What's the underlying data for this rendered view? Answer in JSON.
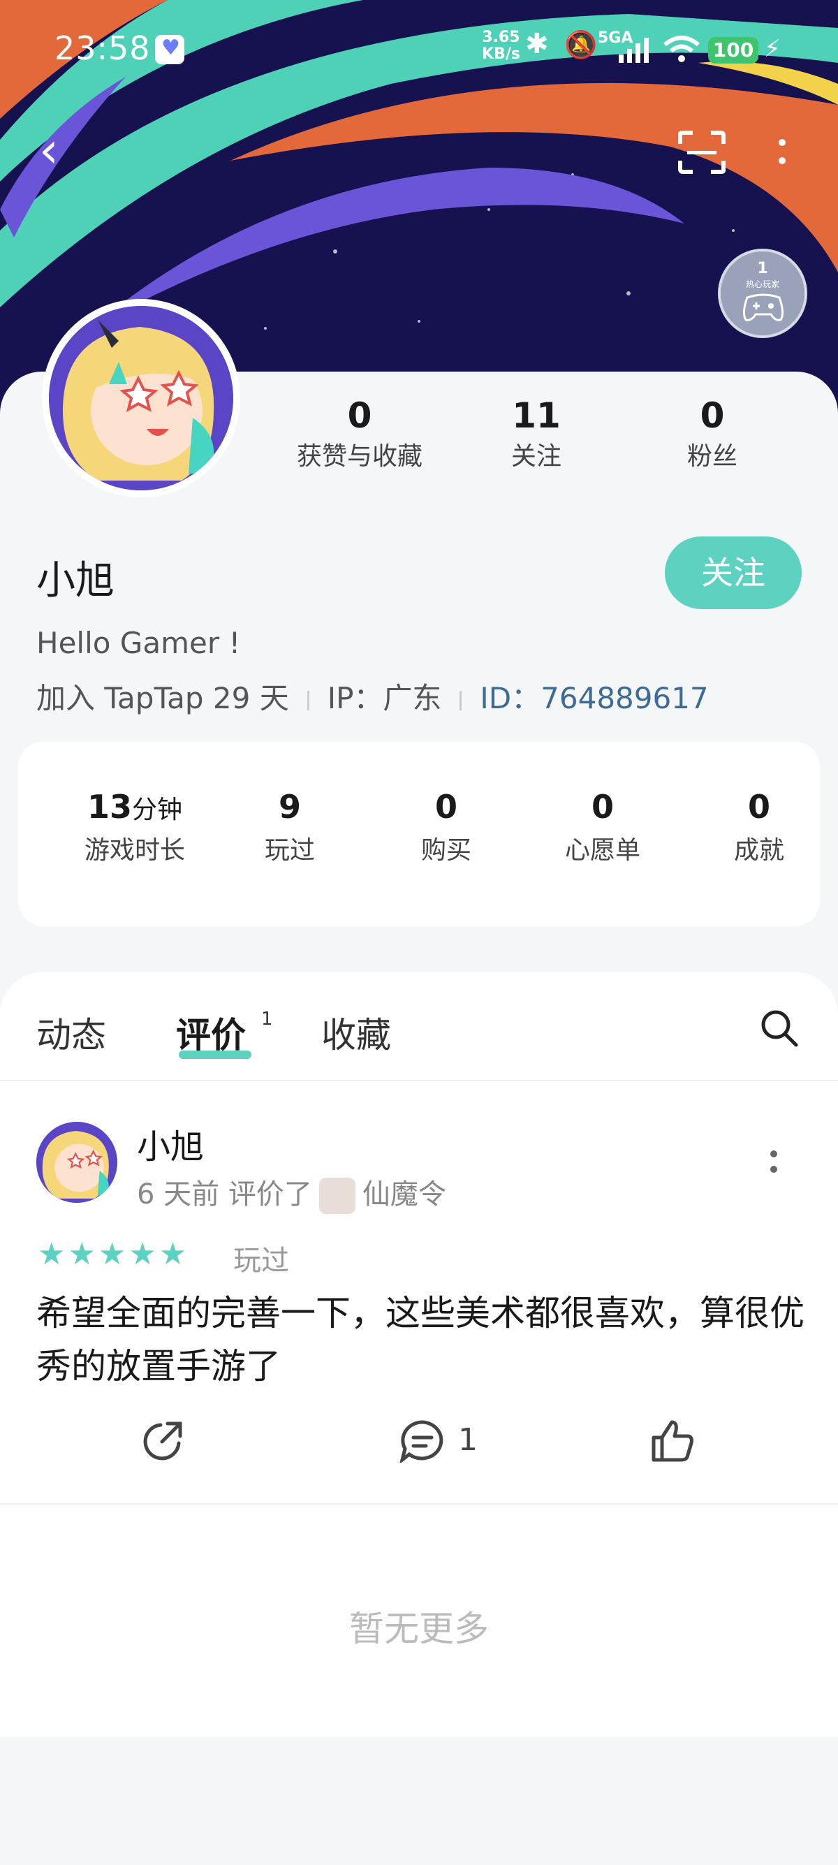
{
  "status_bar": {
    "time": "23:58",
    "net_speed": "3.65",
    "net_unit": "KB/s",
    "signal_label": "5GA",
    "battery": "100"
  },
  "header": {
    "back_icon": "chevron-left-icon",
    "scan_icon": "scan-icon",
    "more_icon": "more-vertical-icon",
    "badge_level": "1",
    "badge_label": "热心玩家"
  },
  "profile": {
    "stats": [
      {
        "value": "0",
        "label": "获赞与收藏"
      },
      {
        "value": "11",
        "label": "关注"
      },
      {
        "value": "0",
        "label": "粉丝"
      }
    ],
    "name": "小旭",
    "follow_label": "关注",
    "bio": "Hello Gamer !",
    "joined": "加入 TapTap 29 天",
    "ip": "IP：广东",
    "id": "ID：764889617"
  },
  "game_stats": [
    {
      "value": "13",
      "unit": "分钟",
      "label": "游戏时长"
    },
    {
      "value": "9",
      "unit": "",
      "label": "玩过"
    },
    {
      "value": "0",
      "unit": "",
      "label": "购买"
    },
    {
      "value": "0",
      "unit": "",
      "label": "心愿单"
    },
    {
      "value": "0",
      "unit": "",
      "label": "成就"
    }
  ],
  "tabs": {
    "items": [
      "动态",
      "评价",
      "收藏"
    ],
    "active": "评价",
    "active_count": "1"
  },
  "review": {
    "author": "小旭",
    "time": "6 天前",
    "action": "评价了",
    "game": "仙魔令",
    "rating": 5,
    "stars": "★★★★★",
    "status": "玩过",
    "text": "希望全面的完善一下，这些美术都很喜欢，算很优秀的放置手游了",
    "comment_count": "1"
  },
  "footer": {
    "no_more": "暂无更多"
  },
  "colors": {
    "accent": "#5ed2c0",
    "banner_bg": "#15124f",
    "id_link": "#3d6b96"
  }
}
